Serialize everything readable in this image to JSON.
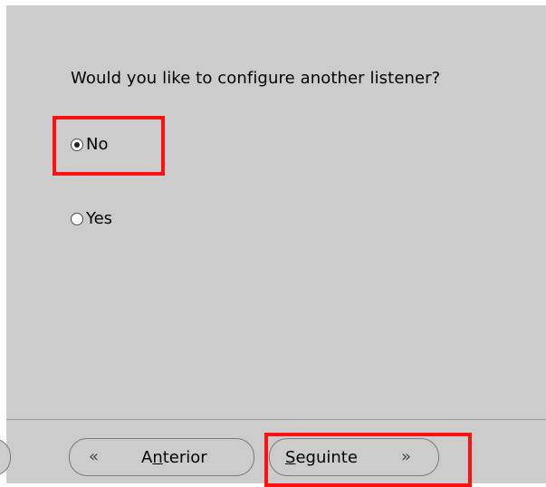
{
  "question": "Would you like to configure another listener?",
  "options": [
    {
      "label": "No",
      "selected": true
    },
    {
      "label": "Yes",
      "selected": false
    }
  ],
  "buttons": {
    "back": {
      "pre": "A",
      "mnemonic": "n",
      "post": "terior"
    },
    "next": {
      "pre": "",
      "mnemonic": "S",
      "post": "eguinte"
    }
  },
  "icons": {
    "back_chevron": "«",
    "next_chevron": "»"
  },
  "colors": {
    "panel": "#cccccc",
    "highlight": "#ff1111",
    "background": "#ffffff"
  }
}
